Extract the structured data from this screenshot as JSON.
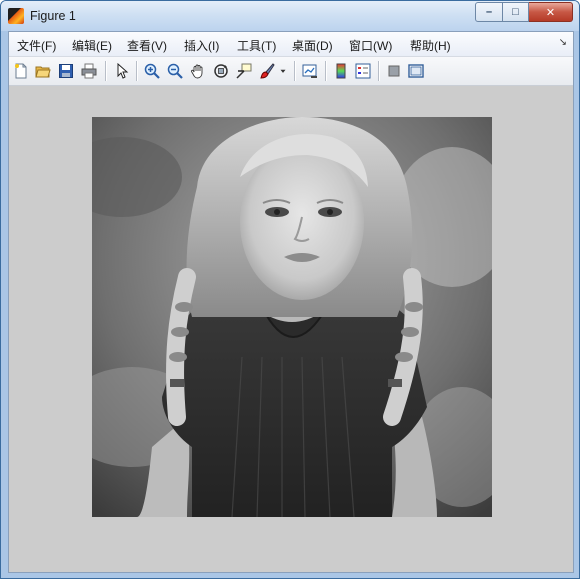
{
  "window": {
    "title": "Figure 1",
    "controls": {
      "minimize": "–",
      "maximize": "□",
      "close": "✕"
    }
  },
  "menubar": {
    "items": [
      {
        "label": "文件(F)"
      },
      {
        "label": "编辑(E)"
      },
      {
        "label": "查看(V)"
      },
      {
        "label": "插入(I)"
      },
      {
        "label": "工具(T)"
      },
      {
        "label": "桌面(D)"
      },
      {
        "label": "窗口(W)"
      },
      {
        "label": "帮助(H)"
      }
    ],
    "overflow_glyph": "↘"
  },
  "toolbar": {
    "tools": [
      {
        "icon": "new-figure-icon"
      },
      {
        "icon": "open-file-icon"
      },
      {
        "icon": "save-icon"
      },
      {
        "icon": "print-icon"
      },
      {
        "icon": "edit-plot-icon"
      },
      {
        "icon": "zoom-in-icon"
      },
      {
        "icon": "zoom-out-icon"
      },
      {
        "icon": "pan-icon"
      },
      {
        "icon": "rotate-3d-icon"
      },
      {
        "icon": "data-cursor-icon"
      },
      {
        "icon": "brush-icon"
      },
      {
        "icon": "link-plot-icon"
      },
      {
        "icon": "colorbar-icon"
      },
      {
        "icon": "legend-icon"
      },
      {
        "icon": "hide-plot-tools-icon"
      },
      {
        "icon": "show-plot-tools-icon"
      }
    ]
  },
  "figure": {
    "background_color": "#cccccc",
    "image": {
      "content": "grayscale photo of a child with braided hair wearing a dark sleeveless top"
    }
  }
}
